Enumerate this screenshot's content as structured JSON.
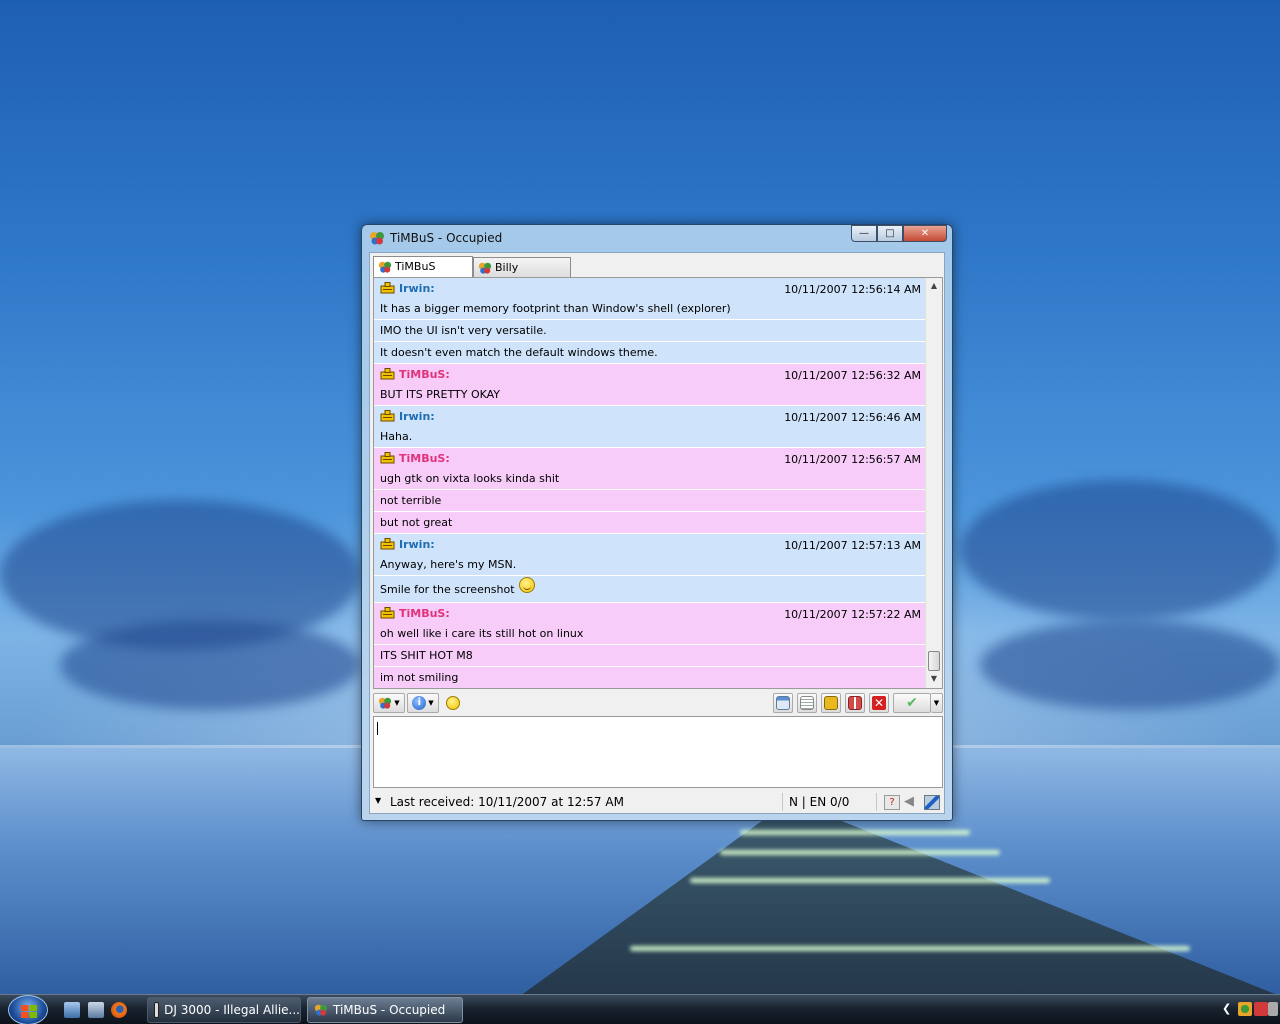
{
  "window": {
    "title": "TiMBuS - Occupied",
    "buttons": {
      "minimize": "—",
      "maximize": "□",
      "close": "✕"
    }
  },
  "tabs": [
    {
      "label": "TiMBuS",
      "active": true
    },
    {
      "label": "Billy",
      "active": false
    }
  ],
  "messages": [
    {
      "sender": "Irwin:",
      "color": "blue",
      "timestamp": "10/11/2007 12:56:14 AM",
      "lines": [
        "It has a bigger memory footprint than Window's shell (explorer)",
        "IMO the UI isn't very versatile.",
        "It doesn't even match the default windows theme."
      ]
    },
    {
      "sender": "TiMBuS:",
      "color": "pink",
      "timestamp": "10/11/2007 12:56:32 AM",
      "lines": [
        "BUT ITS PRETTY OKAY"
      ]
    },
    {
      "sender": "Irwin:",
      "color": "blue",
      "timestamp": "10/11/2007 12:56:46 AM",
      "lines": [
        "Haha."
      ]
    },
    {
      "sender": "TiMBuS:",
      "color": "pink",
      "timestamp": "10/11/2007 12:56:57 AM",
      "lines": [
        "ugh gtk on vixta looks kinda shit",
        "not terrible",
        "but not great"
      ]
    },
    {
      "sender": "Irwin:",
      "color": "blue",
      "timestamp": "10/11/2007 12:57:13 AM",
      "lines": [
        "Anyway, here's my MSN.",
        "Smile for the screenshot"
      ]
    },
    {
      "sender": "TiMBuS:",
      "color": "pink",
      "timestamp": "10/11/2007 12:57:22 AM",
      "lines": [
        "oh well like i care its still hot on linux",
        "ITS SHIT HOT M8",
        "im not smiling"
      ]
    }
  ],
  "input": {
    "value": ""
  },
  "status": {
    "last_received": "Last received: 10/11/2007 at 12:57 AM",
    "language": "N | EN 0/0"
  },
  "taskbar": {
    "tasks": [
      {
        "label": "DJ 3000 - Illegal Allie...",
        "active": false
      },
      {
        "label": "TiMBuS - Occupied",
        "active": true
      }
    ]
  },
  "colors": {
    "blue_row": "#cfe3fa",
    "pink_row": "#f7ccf8",
    "blue_nick": "#1f6db3",
    "pink_nick": "#e0337a"
  }
}
